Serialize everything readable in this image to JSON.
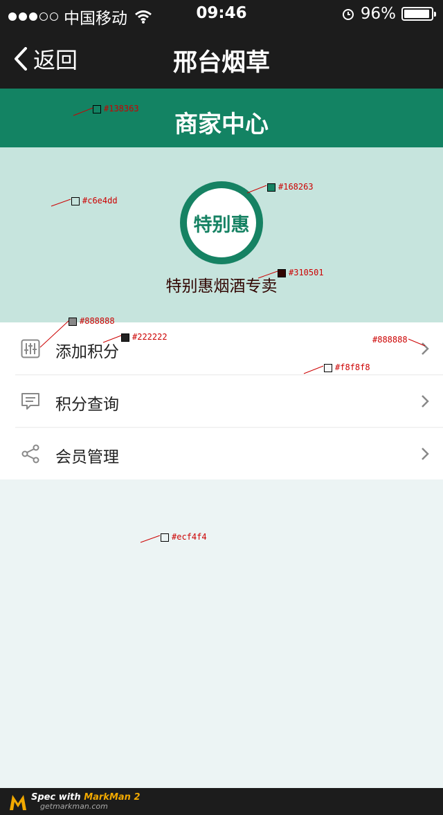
{
  "status_bar": {
    "carrier": "中国移动",
    "time": "09:46",
    "battery": "96%",
    "battery_level": 0.96
  },
  "nav": {
    "back_label": "返回",
    "title": "邢台烟草"
  },
  "header": {
    "title": "商家中心"
  },
  "profile": {
    "logo_text": "特别惠",
    "store_name": "特别惠烟酒专卖"
  },
  "menu": [
    {
      "label": "添加积分",
      "icon": "sliders-icon"
    },
    {
      "label": "积分查询",
      "icon": "message-icon"
    },
    {
      "label": "会员管理",
      "icon": "share-icon"
    }
  ],
  "annotations": {
    "a1": "#138363",
    "a2": "#c6e4dd",
    "a3": "#168263",
    "a4": "#310501",
    "a5": "#888888",
    "a6": "#222222",
    "a7": "#888888",
    "a8": "#f8f8f8",
    "a9": "#ecf4f4"
  },
  "footer": {
    "spec_prefix": "Spec with ",
    "spec_brand": "MarkMan 2",
    "url": "getmarkman.com"
  },
  "colors": {
    "nav_bg": "#1c1c1c",
    "header_green": "#138363",
    "profile_bg": "#c6e4dd",
    "logo_green": "#168263",
    "page_bg": "#ecf4f4"
  }
}
